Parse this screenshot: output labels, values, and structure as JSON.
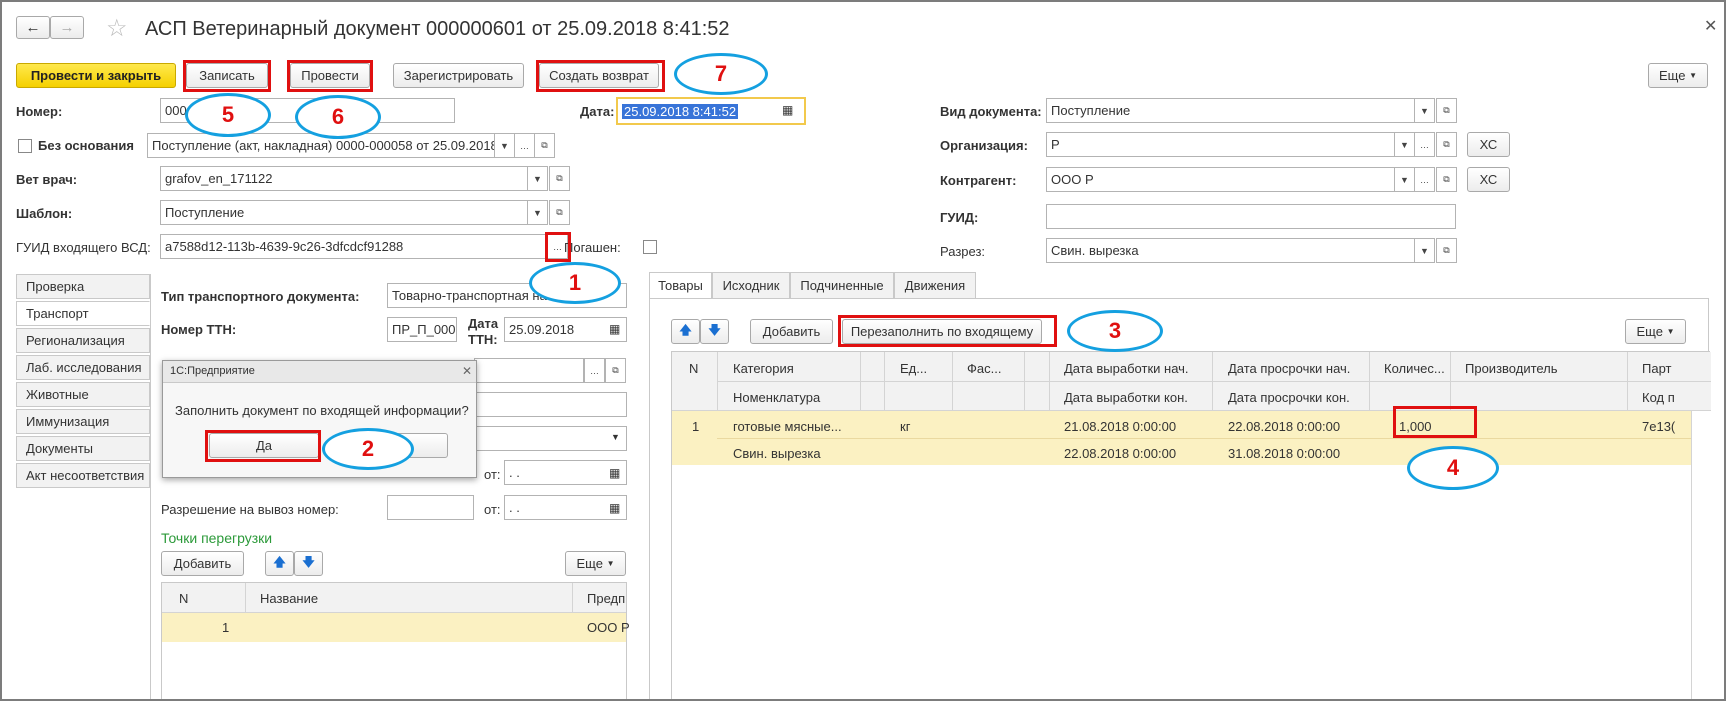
{
  "title": "АСП Ветеринарный документ 000000601 от 25.09.2018 8:41:52",
  "toolbar": {
    "post_close": "Провести и закрыть",
    "write": "Записать",
    "post": "Провести",
    "register": "Зарегистрировать",
    "create_return": "Создать возврат",
    "more": "Еще"
  },
  "form": {
    "number_label": "Номер:",
    "number_value": "000",
    "date_label": "Дата:",
    "date_value": "25.09.2018  8:41:52",
    "no_basis_label": "Без основания",
    "basis_value": "Поступление (акт, накладная) 0000-000058 от 25.09.2018",
    "vet_label": "Вет врач:",
    "vet_value": "grafov_en_171122",
    "template_label": "Шаблон:",
    "template_value": "Поступление",
    "guid_in_label": "ГУИД входящего ВСД:",
    "guid_in_value": "a7588d12-113b-4639-9c26-3dfcdcf91288",
    "extinguished_label": "Погашен:",
    "doc_type_label": "Вид документа:",
    "doc_type_value": "Поступление",
    "org_label": "Организация:",
    "org_value": "Р",
    "counterparty_label": "Контрагент:",
    "counterparty_value": "ООО Р",
    "guid_label": "ГУИД:",
    "section_label": "Разрез:",
    "section_value": "Свин. вырезка",
    "xc": "ХС"
  },
  "left_tabs": [
    "Проверка",
    "Транспорт",
    "Регионализация",
    "Лаб. исследования",
    "Животные",
    "Иммунизация",
    "Документы",
    "Акт несоответствия"
  ],
  "transport": {
    "doc_type_label": "Тип транспортного документа:",
    "doc_type_value": "Товарно-транспортная на",
    "ttn_label": "Номер ТТН:",
    "ttn_value": "ПР_П_000(",
    "ttn_date_label1": "Дата",
    "ttn_date_label2": "ТТН:",
    "ttn_date_value": "25.09.2018",
    "from_label": "от:",
    "empty_date": " .  .",
    "permit_label": "Разрешение на вывоз номер:",
    "reload_points": "Точки перегрузки",
    "add": "Добавить",
    "more": "Еще",
    "col_n": "N",
    "col_name": "Название",
    "col_pred": "Предп",
    "row_n": "1",
    "row_pred": "ООО Р"
  },
  "dialog": {
    "title": "1С:Предприятие",
    "question": "Заполнить документ по входящей информации?",
    "yes": "Да"
  },
  "right_tabs": [
    "Товары",
    "Исходник",
    "Подчиненные",
    "Движения"
  ],
  "goods": {
    "add": "Добавить",
    "refill": "Перезаполнить по входящему",
    "more": "Еще",
    "headers": {
      "n": "N",
      "category": "Категория",
      "nomenclature": "Номенклатура",
      "unit": "Ед...",
      "package": "Фас...",
      "prod_start": "Дата выработки нач.",
      "prod_end": "Дата выработки кон.",
      "exp_start": "Дата просрочки нач.",
      "exp_end": "Дата просрочки кон.",
      "qty": "Количес...",
      "producer": "Производитель",
      "batch": "Парт",
      "batch_code": "Код п"
    },
    "row": {
      "n": "1",
      "category": "готовые мясные...",
      "nomenclature": "Свин. вырезка",
      "unit": "кг",
      "prod_start": "21.08.2018 0:00:00",
      "prod_end": "22.08.2018 0:00:00",
      "exp_start": "22.08.2018 0:00:00",
      "exp_end": "31.08.2018 0:00:00",
      "qty": "1,000",
      "batch": "7e13("
    }
  },
  "annotations": [
    "1",
    "2",
    "3",
    "4",
    "5",
    "6",
    "7"
  ]
}
